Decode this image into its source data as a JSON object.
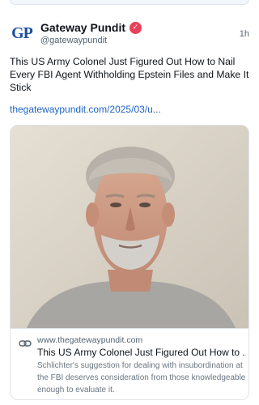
{
  "post": {
    "author": {
      "avatar_text": "GP",
      "display_name": "Gateway Pundit",
      "handle": "@gatewaypundit",
      "verified_icon": "check-badge-icon"
    },
    "time": "1h",
    "text": "This US Army Colonel Just Figured Out How to Nail Every FBI Agent Withholding Epstein Files and Make It Stick",
    "link": "thegatewaypundit.com/2025/03/u..."
  },
  "card": {
    "image_icon": "portrait-photo",
    "domain": "www.thegatewaypundit.com",
    "title": "This US Army Colonel Just Figured Out How to ...",
    "description": "Schlichter's suggestion for dealing with insubordination at the FBI deserves consideration from those knowledgeable enough to evaluate it."
  },
  "colors": {
    "link": "#1d63c9",
    "verified_badge": "#e8415a",
    "avatar_brand": "#1b4f9c"
  }
}
